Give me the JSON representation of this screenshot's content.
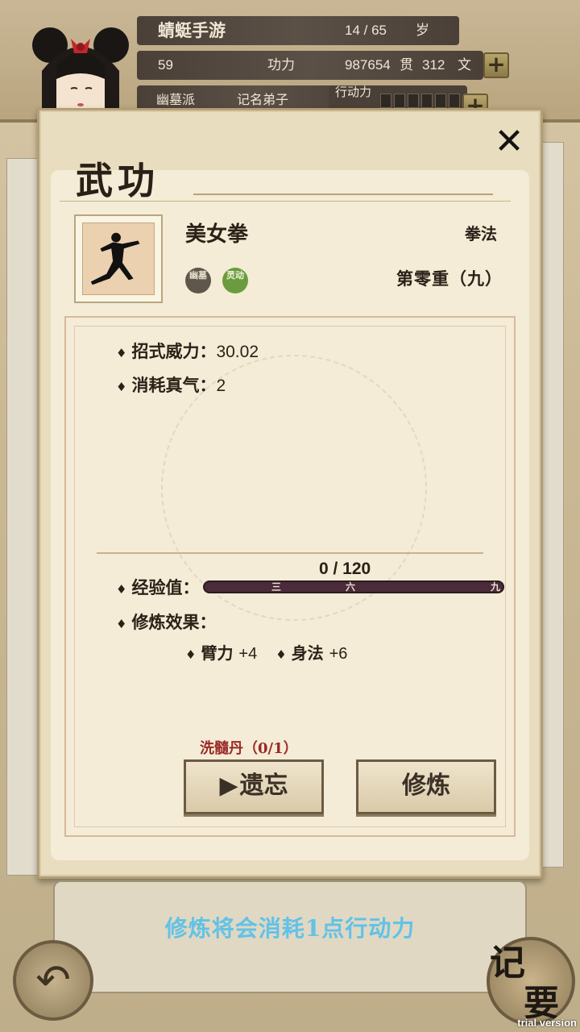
{
  "status_bar": {
    "game_name": "蜻蜓手游",
    "age_value": "14 / 65",
    "age_unit": "岁",
    "level": "59",
    "level_label": "功力",
    "money_guan": "987654",
    "guan_unit": "贯",
    "money_wen": "312",
    "wen_unit": "文",
    "sect": "幽墓派",
    "rank": "记名弟子",
    "action_label": "行动力",
    "plus_symbol": "+"
  },
  "modal": {
    "title": "武功",
    "close_symbol": "✕",
    "skill": {
      "name": "美女拳",
      "type": "拳法",
      "level": "第零重（九）",
      "seals": [
        "幽墓",
        "灵动"
      ]
    },
    "stats": {
      "power_label": "招式威力：",
      "power_value": "30.02",
      "cost_label": "消耗真气：",
      "cost_value": "2"
    },
    "experience": {
      "label": "经验值：",
      "text": "0 / 120",
      "current": 0,
      "max": 120,
      "marks": [
        "三",
        "六",
        "九"
      ]
    },
    "effects": {
      "label": "修炼效果：",
      "items": [
        {
          "name": "臂力",
          "value": "+4"
        },
        {
          "name": "身法",
          "value": "+6"
        }
      ]
    },
    "pill_text": "洗髓丹（0/1）",
    "buttons": {
      "forget_icon": "▶",
      "forget": "遗忘",
      "train": "修炼"
    }
  },
  "bottom": {
    "tip": "修炼将会消耗1点行动力",
    "back_icon": "↶",
    "memo_char1": "记",
    "memo_char2": "要",
    "trial": "trial version"
  },
  "colors": {
    "tip": "#62c2e6",
    "pill": "#9a2a28",
    "exp_bar": "#4b2b3a"
  }
}
